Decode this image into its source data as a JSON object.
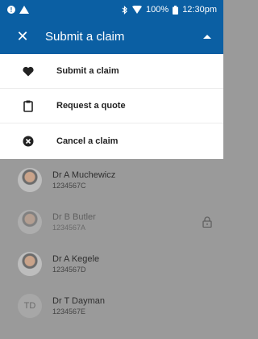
{
  "status_bar": {
    "battery": "100%",
    "time": "12:30pm"
  },
  "app_bar": {
    "close_glyph": "✕",
    "title": "Submit a claim"
  },
  "menu": {
    "items": [
      {
        "label": "Submit a claim",
        "icon": "heart-icon"
      },
      {
        "label": "Request a quote",
        "icon": "clipboard-icon"
      },
      {
        "label": "Cancel a claim",
        "icon": "cancel-circle-icon"
      }
    ]
  },
  "list": {
    "rows": [
      {
        "name": "Dr A Muchewicz",
        "id": "1234567C",
        "avatar": "photo",
        "locked": false
      },
      {
        "name": "Dr B Butler",
        "id": "1234567A",
        "avatar": "photo",
        "locked": true
      },
      {
        "name": "Dr A Kegele",
        "id": "1234567D",
        "avatar": "photo",
        "locked": false
      },
      {
        "name": "Dr T Dayman",
        "id": "1234567E",
        "avatar": "initials",
        "initials": "TD",
        "locked": false
      }
    ]
  }
}
